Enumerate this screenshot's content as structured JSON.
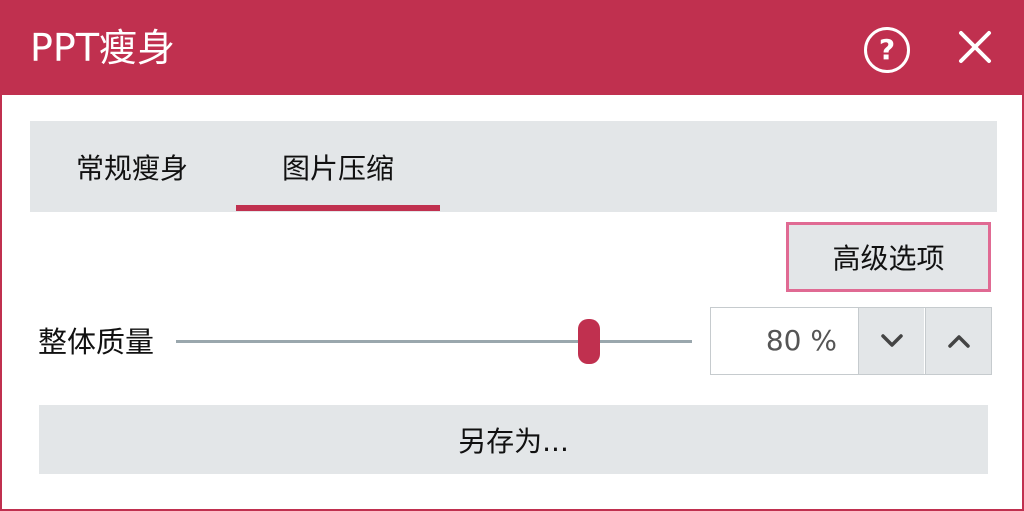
{
  "window": {
    "title": "PPT瘦身",
    "help_glyph": "?",
    "accent_color": "#c0304f"
  },
  "tabs": [
    {
      "label": "常规瘦身",
      "selected": false
    },
    {
      "label": "图片压缩",
      "selected": true
    }
  ],
  "advanced_button": {
    "label": "高级选项"
  },
  "quality": {
    "label": "整体质量",
    "value": 80,
    "display": "80 %"
  },
  "save_as_button": {
    "label": "另存为..."
  },
  "icons": {
    "help": "help-circle-icon",
    "close": "close-icon",
    "down": "chevron-down-icon",
    "up": "chevron-up-icon"
  }
}
